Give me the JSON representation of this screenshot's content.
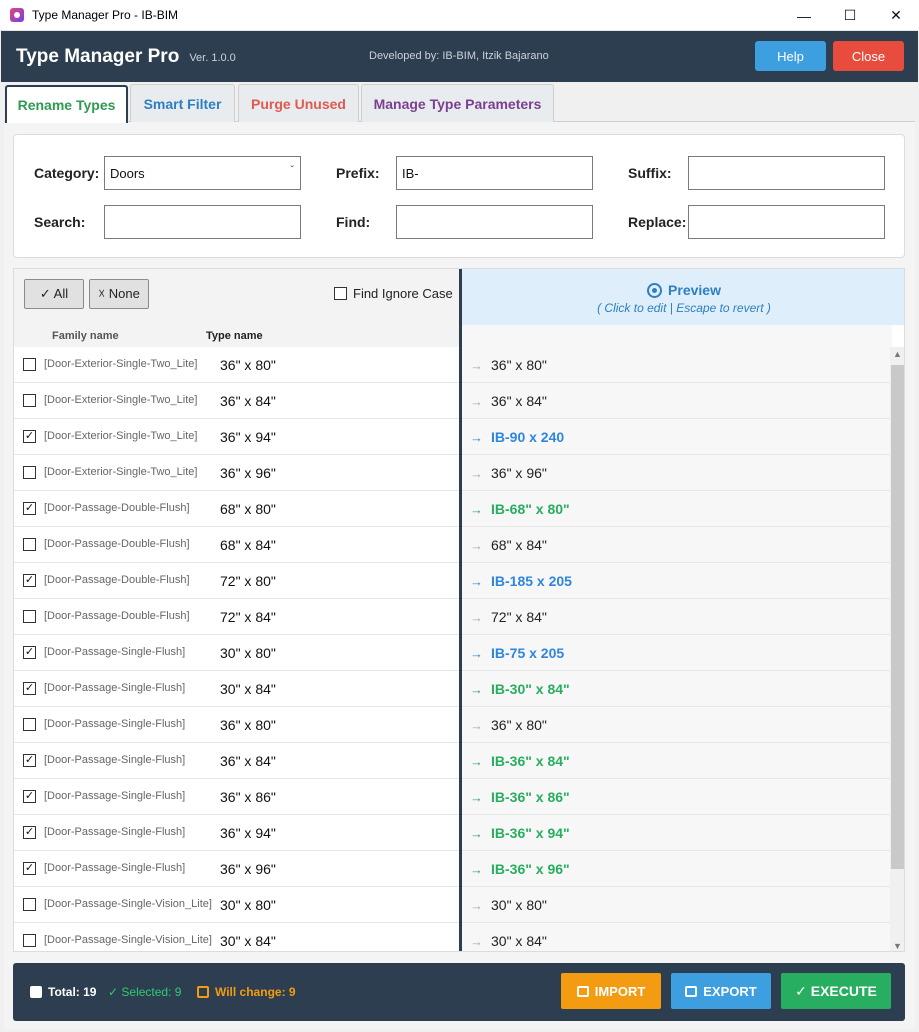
{
  "window": {
    "title": "Type Manager Pro - IB-BIM"
  },
  "header": {
    "brand": "Type Manager Pro",
    "version": "Ver. 1.0.0",
    "developer": "Developed by: IB-BIM, Itzik Bajarano",
    "help_label": "Help",
    "close_label": "Close"
  },
  "tabs": [
    {
      "label": "Rename Types",
      "color": "#2e9a52",
      "active": true
    },
    {
      "label": "Smart Filter",
      "color": "#2e7fc2",
      "active": false
    },
    {
      "label": "Purge Unused",
      "color": "#e05a4e",
      "active": false
    },
    {
      "label": "Manage Type Parameters",
      "color": "#7b3f8f",
      "active": false
    }
  ],
  "filter": {
    "category_label": "Category:",
    "category_value": "Doors",
    "prefix_label": "Prefix:",
    "prefix_value": "IB-",
    "suffix_label": "Suffix:",
    "suffix_value": "",
    "search_label": "Search:",
    "search_value": "",
    "find_label": "Find:",
    "find_value": "",
    "replace_label": "Replace:",
    "replace_value": ""
  },
  "toolbar": {
    "all_label": "✓ All",
    "none_label": "☓ None",
    "ignore_case_label": "Find Ignore Case"
  },
  "preview": {
    "title": "Preview",
    "subtitle": "( Click to edit  |  Escape to revert )"
  },
  "columns": {
    "family": "Family name",
    "type": "Type name"
  },
  "rows": [
    {
      "checked": false,
      "family": "[Door-Exterior-Single-Two_Lite]",
      "type": "36\" x 80\"",
      "preview": "36\" x 80\"",
      "state": "none"
    },
    {
      "checked": false,
      "family": "[Door-Exterior-Single-Two_Lite]",
      "type": "36\" x 84\"",
      "preview": "36\" x 84\"",
      "state": "none"
    },
    {
      "checked": true,
      "family": "[Door-Exterior-Single-Two_Lite]",
      "type": "36\" x 94\"",
      "preview": "IB-90 x 240",
      "state": "blue"
    },
    {
      "checked": false,
      "family": "[Door-Exterior-Single-Two_Lite]",
      "type": "36\" x 96\"",
      "preview": "36\" x 96\"",
      "state": "none"
    },
    {
      "checked": true,
      "family": "[Door-Passage-Double-Flush]",
      "type": "68\" x 80\"",
      "preview": "IB-68\" x 80\"",
      "state": "green"
    },
    {
      "checked": false,
      "family": "[Door-Passage-Double-Flush]",
      "type": "68\" x 84\"",
      "preview": "68\" x 84\"",
      "state": "none"
    },
    {
      "checked": true,
      "family": "[Door-Passage-Double-Flush]",
      "type": "72\" x 80\"",
      "preview": "IB-185 x 205",
      "state": "blue"
    },
    {
      "checked": false,
      "family": "[Door-Passage-Double-Flush]",
      "type": "72\" x 84\"",
      "preview": "72\" x 84\"",
      "state": "none"
    },
    {
      "checked": true,
      "family": "[Door-Passage-Single-Flush]",
      "type": "30\" x 80\"",
      "preview": "IB-75 x 205",
      "state": "blue"
    },
    {
      "checked": true,
      "family": "[Door-Passage-Single-Flush]",
      "type": "30\" x 84\"",
      "preview": "IB-30\" x 84\"",
      "state": "green"
    },
    {
      "checked": false,
      "family": "[Door-Passage-Single-Flush]",
      "type": "36\" x 80\"",
      "preview": "36\" x 80\"",
      "state": "none"
    },
    {
      "checked": true,
      "family": "[Door-Passage-Single-Flush]",
      "type": "36\" x 84\"",
      "preview": "IB-36\" x 84\"",
      "state": "green"
    },
    {
      "checked": true,
      "family": "[Door-Passage-Single-Flush]",
      "type": "36\" x 86\"",
      "preview": "IB-36\" x 86\"",
      "state": "green"
    },
    {
      "checked": true,
      "family": "[Door-Passage-Single-Flush]",
      "type": "36\" x 94\"",
      "preview": "IB-36\" x 94\"",
      "state": "green"
    },
    {
      "checked": true,
      "family": "[Door-Passage-Single-Flush]",
      "type": "36\" x 96\"",
      "preview": "IB-36\" x 96\"",
      "state": "green"
    },
    {
      "checked": false,
      "family": "[Door-Passage-Single-Vision_Lite]",
      "type": "30\" x 80\"",
      "preview": "30\" x 80\"",
      "state": "none"
    },
    {
      "checked": false,
      "family": "[Door-Passage-Single-Vision_Lite]",
      "type": "30\" x 84\"",
      "preview": "30\" x 84\"",
      "state": "none"
    }
  ],
  "footer": {
    "total": "Total: 19",
    "selected": "✓ Selected: 9",
    "will_change": "Will change: 9",
    "import_label": "IMPORT",
    "export_label": "EXPORT",
    "execute_label": "✓ EXECUTE"
  },
  "colors": {
    "header_bg": "#2d3e50",
    "help": "#3d9ee0",
    "close": "#e74c3c",
    "import": "#f39c12",
    "export": "#3d9ee0",
    "execute": "#27ae60"
  }
}
